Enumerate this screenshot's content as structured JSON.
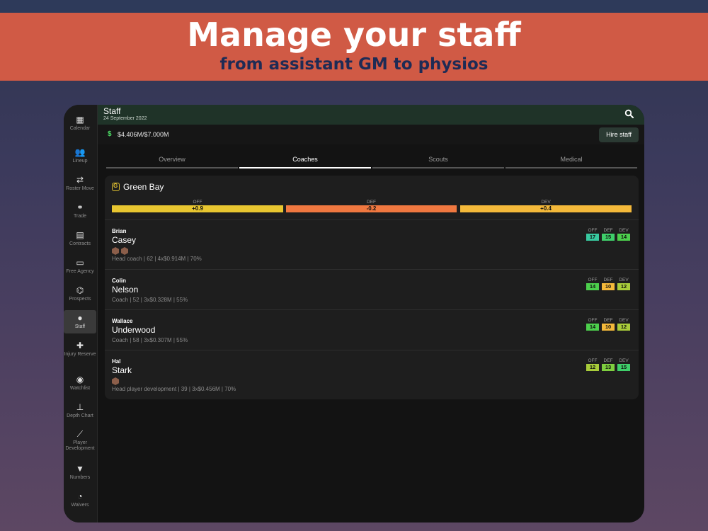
{
  "banner": {
    "title": "Manage your staff",
    "subtitle": "from assistant GM to physios"
  },
  "sidebar": {
    "items": [
      {
        "label": "Calendar",
        "icon": "calendar-icon"
      },
      {
        "label": "Lineup",
        "icon": "group-icon"
      },
      {
        "label": "Roster Move",
        "icon": "swap-arrows-icon"
      },
      {
        "label": "Trade",
        "icon": "handshake-icon"
      },
      {
        "label": "Contracts",
        "icon": "document-icon"
      },
      {
        "label": "Free Agency",
        "icon": "money-icon"
      },
      {
        "label": "Prospects",
        "icon": "binoculars-icon"
      },
      {
        "label": "Staff",
        "icon": "person-icon",
        "active": true
      },
      {
        "label": "Injury Reserve",
        "icon": "injured-person-icon"
      },
      {
        "label": "Watchlist",
        "icon": "eye-icon"
      },
      {
        "label": "Depth Chart",
        "icon": "hierarchy-icon"
      },
      {
        "label": "Player Development",
        "icon": "chart-line-icon"
      },
      {
        "label": "Numbers",
        "icon": "jersey-icon"
      },
      {
        "label": "Waivers",
        "icon": "person-clock-icon"
      }
    ]
  },
  "header": {
    "title": "Staff",
    "date": "24 September 2022"
  },
  "budget": {
    "symbol": "$",
    "text": "$4.406M/$7.000M",
    "hire_label": "Hire staff"
  },
  "tabs": [
    {
      "label": "Overview"
    },
    {
      "label": "Coaches",
      "active": true
    },
    {
      "label": "Scouts"
    },
    {
      "label": "Medical"
    }
  ],
  "team": {
    "name": "Green Bay",
    "ratings": [
      {
        "label": "OFF",
        "value": "+0.9",
        "color": "#e8c630"
      },
      {
        "label": "DEF",
        "value": "-0.2",
        "color": "#f07840"
      },
      {
        "label": "DEV",
        "value": "+0.4",
        "color": "#f4b93a"
      }
    ]
  },
  "stat_labels": [
    "OFF",
    "DEF",
    "DEV"
  ],
  "staff": [
    {
      "first": "Brian",
      "last": "Casey",
      "badges": 2,
      "info": "Head coach | 62 | 4x$0.914M | 70%",
      "stats": [
        {
          "value": "17",
          "color": "#38c9a0"
        },
        {
          "value": "15",
          "color": "#3fcf6a"
        },
        {
          "value": "14",
          "color": "#4ccf4c"
        }
      ]
    },
    {
      "first": "Colin",
      "last": "Nelson",
      "badges": 0,
      "info": "Coach | 52 | 3x$0.328M | 55%",
      "stats": [
        {
          "value": "14",
          "color": "#4ccf4c"
        },
        {
          "value": "10",
          "color": "#f4b93a"
        },
        {
          "value": "12",
          "color": "#a8cc3a"
        }
      ]
    },
    {
      "first": "Wallace",
      "last": "Underwood",
      "badges": 0,
      "info": "Coach | 58 | 3x$0.307M | 55%",
      "stats": [
        {
          "value": "14",
          "color": "#4ccf4c"
        },
        {
          "value": "10",
          "color": "#f4b93a"
        },
        {
          "value": "12",
          "color": "#a8cc3a"
        }
      ]
    },
    {
      "first": "Hal",
      "last": "Stark",
      "badges": 1,
      "info": "Head player development | 39 | 3x$0.456M | 70%",
      "stats": [
        {
          "value": "12",
          "color": "#a8cc3a"
        },
        {
          "value": "13",
          "color": "#7fcf3f"
        },
        {
          "value": "15",
          "color": "#3fcf6a"
        }
      ]
    }
  ]
}
